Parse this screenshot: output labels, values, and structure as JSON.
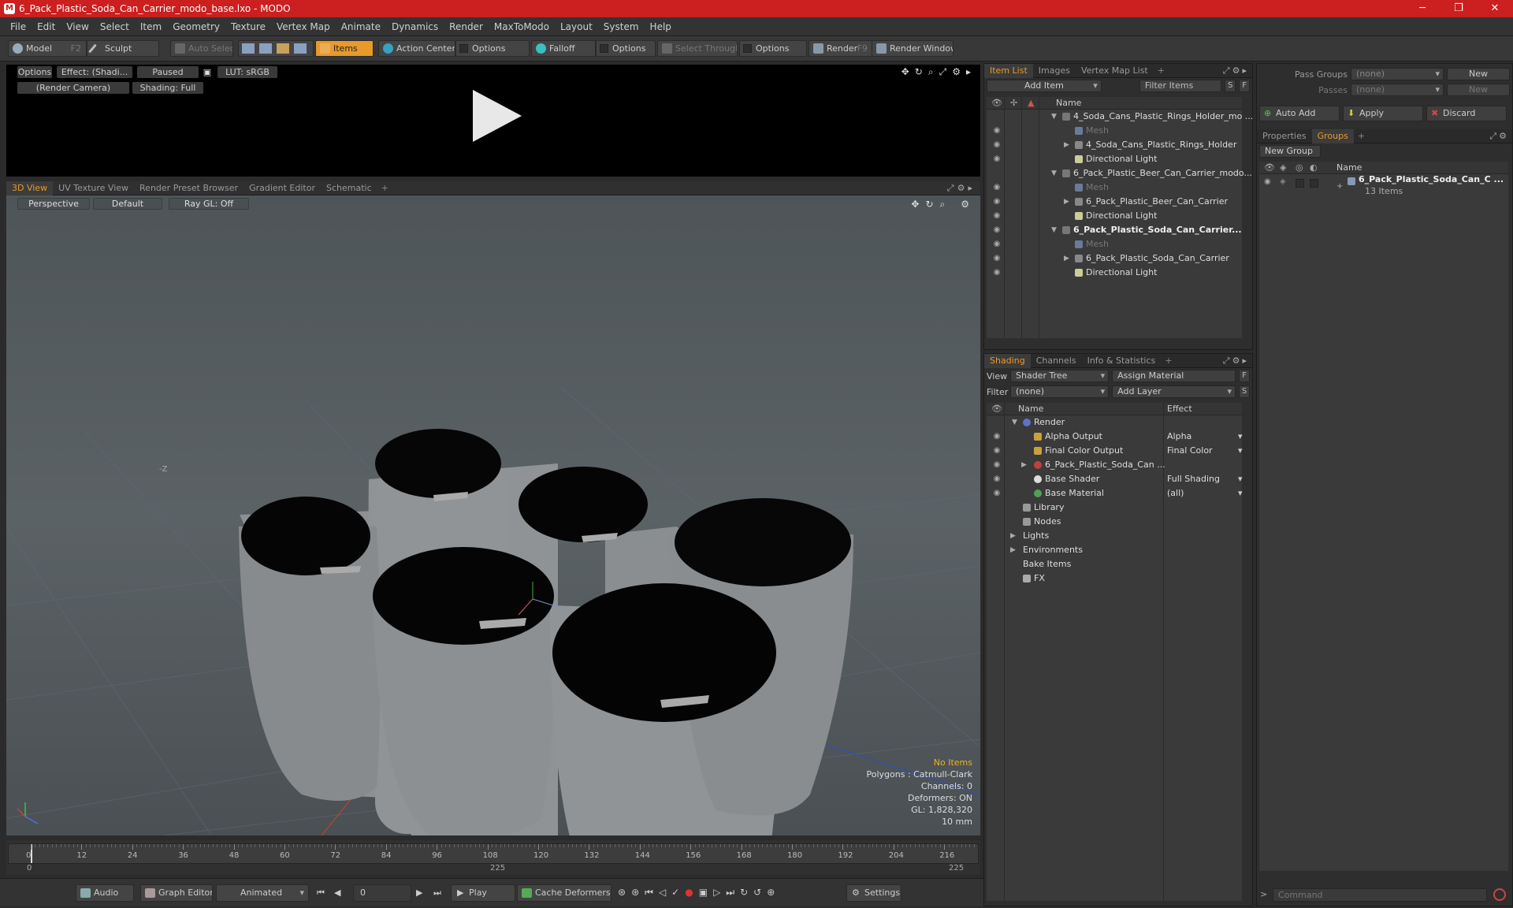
{
  "window": {
    "title": "6_Pack_Plastic_Soda_Can_Carrier_modo_base.lxo - MODO"
  },
  "menu": [
    "File",
    "Edit",
    "View",
    "Select",
    "Item",
    "Geometry",
    "Texture",
    "Vertex Map",
    "Animate",
    "Dynamics",
    "Render",
    "MaxToModo",
    "Layout",
    "System",
    "Help"
  ],
  "toolbar": {
    "model": "Model",
    "model_key": "F2",
    "sculpt": "Sculpt",
    "auto_select": "Auto Select",
    "items": "Items",
    "action_center": "Action Center",
    "options1": "Options",
    "falloff": "Falloff",
    "options2": "Options",
    "select_through": "Select Through",
    "options3": "Options",
    "render": "Render",
    "render_key": "F9",
    "render_window": "Render Window"
  },
  "preview": {
    "options": "Options",
    "effect": "Effect: (Shadi...",
    "paused": "Paused",
    "lut": "LUT: sRGB",
    "camera": "(Render Camera)",
    "shading": "Shading: Full"
  },
  "view_tabs": [
    "3D View",
    "UV Texture View",
    "Render Preset Browser",
    "Gradient Editor",
    "Schematic"
  ],
  "viewport": {
    "perspective": "Perspective",
    "default": "Default",
    "raygl": "Ray GL: Off",
    "axis_label": "-Z",
    "info": {
      "no_items": "No Items",
      "polygons": "Polygons : Catmull-Clark",
      "channels": "Channels: 0",
      "deformers": "Deformers: ON",
      "gl": "GL: 1,828,320",
      "scale": "10 mm"
    }
  },
  "timeline": {
    "ticks": [
      "0",
      "12",
      "24",
      "36",
      "48",
      "60",
      "72",
      "84",
      "96",
      "108",
      "120",
      "132",
      "144",
      "156",
      "168",
      "180",
      "192",
      "204",
      "216"
    ],
    "start": "0",
    "mid": "225",
    "end": "225"
  },
  "bottombar": {
    "audio": "Audio",
    "graph_editor": "Graph Editor",
    "animated": "Animated",
    "frame": "0",
    "play": "Play",
    "cache_deformers": "Cache Deformers",
    "settings": "Settings"
  },
  "item_list": {
    "tabs": [
      "Item List",
      "Images",
      "Vertex Map List"
    ],
    "add_item": "Add Item",
    "filter_items": "Filter Items",
    "s": "S",
    "f": "F",
    "col_name": "Name",
    "rows": [
      {
        "label": "4_Soda_Cans_Plastic_Rings_Holder_mo ..."
      },
      {
        "label": "Mesh"
      },
      {
        "label": "4_Soda_Cans_Plastic_Rings_Holder"
      },
      {
        "label": "Directional Light"
      },
      {
        "label": "6_Pack_Plastic_Beer_Can_Carrier_modo..."
      },
      {
        "label": "Mesh"
      },
      {
        "label": "6_Pack_Plastic_Beer_Can_Carrier"
      },
      {
        "label": "Directional Light"
      },
      {
        "label": "6_Pack_Plastic_Soda_Can_Carrier..."
      },
      {
        "label": "Mesh"
      },
      {
        "label": "6_Pack_Plastic_Soda_Can_Carrier"
      },
      {
        "label": "Directional Light"
      }
    ]
  },
  "shading": {
    "tabs": [
      "Shading",
      "Channels",
      "Info & Statistics"
    ],
    "view_label": "View",
    "view_value": "Shader Tree",
    "assign_material": "Assign Material",
    "filter_label": "Filter",
    "filter_value": "(none)",
    "add_layer": "Add Layer",
    "f": "F",
    "s": "S",
    "col_name": "Name",
    "col_effect": "Effect",
    "rows": [
      {
        "label": "Render",
        "effect": ""
      },
      {
        "label": "Alpha Output",
        "effect": "Alpha"
      },
      {
        "label": "Final Color Output",
        "effect": "Final Color"
      },
      {
        "label": "6_Pack_Plastic_Soda_Can ...",
        "effect": ""
      },
      {
        "label": "Base Shader",
        "effect": "Full Shading"
      },
      {
        "label": "Base Material",
        "effect": "(all)"
      },
      {
        "label": "Library",
        "effect": ""
      },
      {
        "label": "Nodes",
        "effect": ""
      },
      {
        "label": "Lights",
        "effect": ""
      },
      {
        "label": "Environments",
        "effect": ""
      },
      {
        "label": "Bake Items",
        "effect": ""
      },
      {
        "label": "FX",
        "effect": ""
      }
    ]
  },
  "groups": {
    "pass_groups": "Pass Groups",
    "passes": "Passes",
    "none": "(none)",
    "new": "New",
    "auto_add": "Auto Add",
    "apply": "Apply",
    "discard": "Discard",
    "tabs": [
      "Properties",
      "Groups"
    ],
    "new_group": "New Group",
    "col_name": "Name",
    "group_name": "6_Pack_Plastic_Soda_Can_C ...",
    "group_count": "13 Items",
    "command_placeholder": "Command"
  }
}
